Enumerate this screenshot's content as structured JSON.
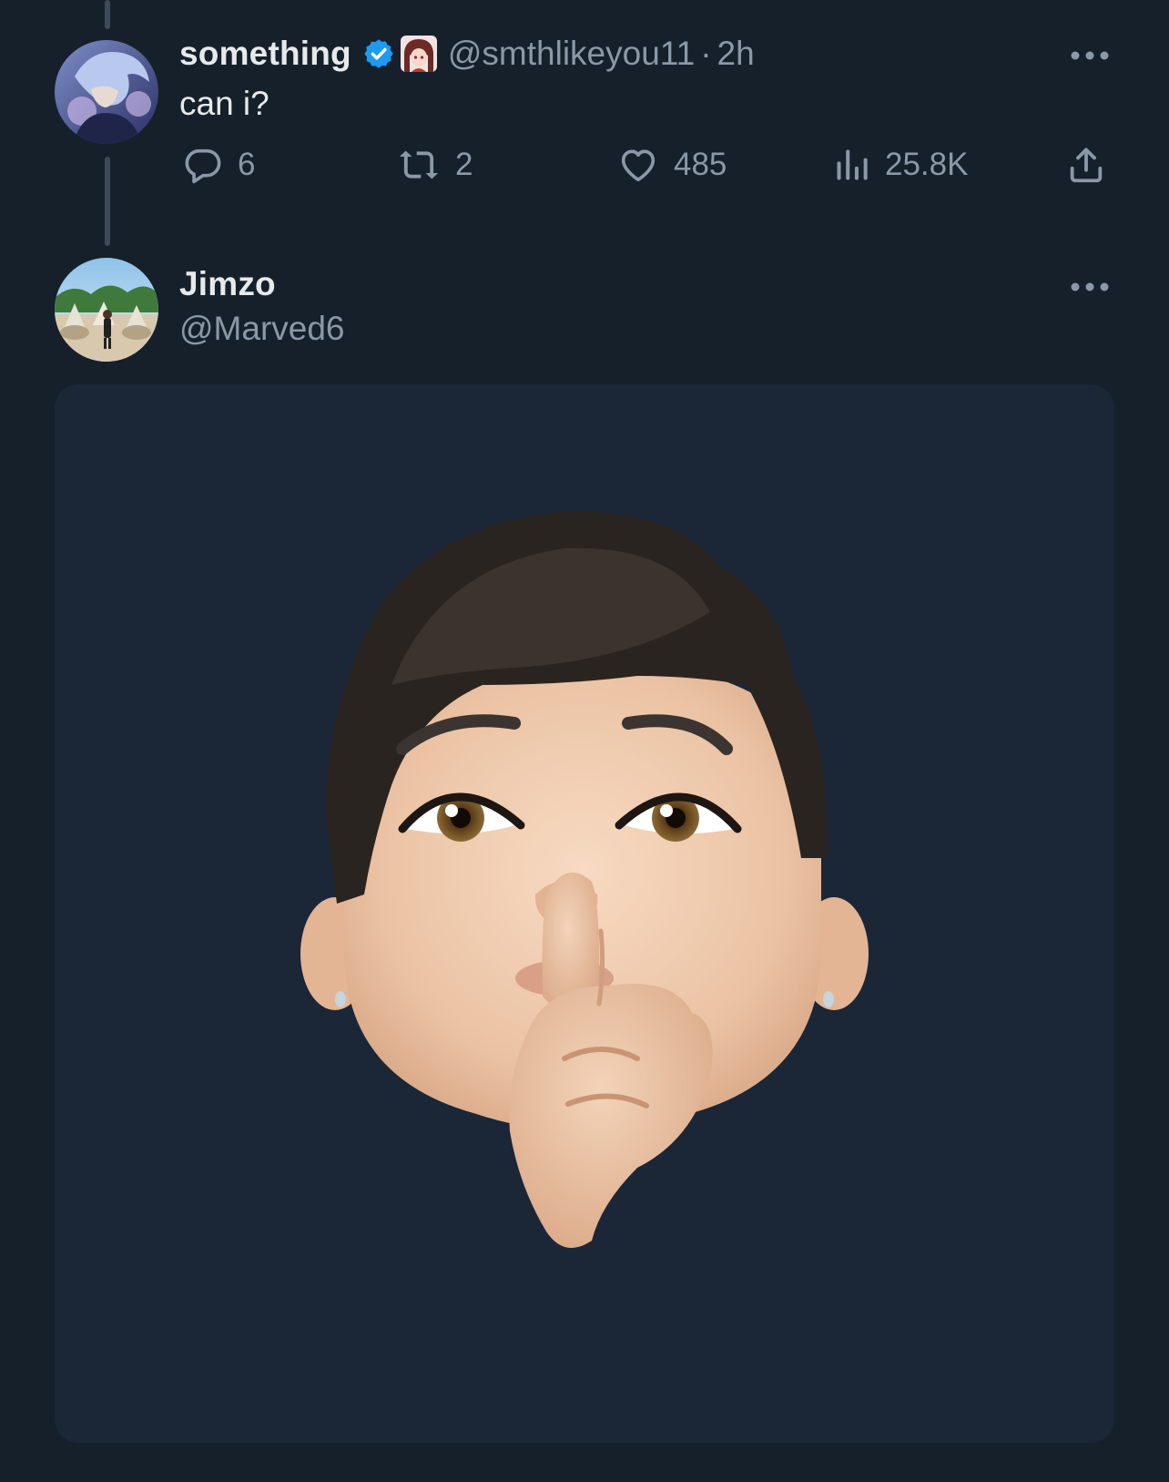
{
  "parent_tweet": {
    "display_name": "something",
    "verified_badge": "verified-badge-icon",
    "affiliate_badge": "anime-avatar-badge",
    "handle": "@smthlikeyou11",
    "separator": "·",
    "time": "2h",
    "text": "can i?",
    "actions": {
      "reply_count": "6",
      "retweet_count": "2",
      "like_count": "485",
      "view_count": "25.8K"
    }
  },
  "reply_tweet": {
    "display_name": "Jimzo",
    "handle": "@Marved6",
    "media": "memoji-shushing-face"
  },
  "colors": {
    "background": "#15202b",
    "text_primary": "#e7e9ea",
    "text_secondary": "#8b98a5",
    "verified_blue": "#1d9bf0",
    "media_background": "#1b2637"
  }
}
